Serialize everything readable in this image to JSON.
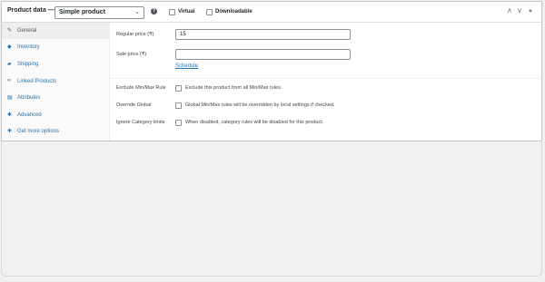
{
  "header": {
    "title": "Product data —",
    "product_type": "Simple product",
    "help_icon": "?",
    "virtual_label": "Virtual",
    "downloadable_label": "Downloadable",
    "controls": [
      "∧",
      "∨",
      "▲"
    ]
  },
  "tabs": [
    {
      "label": "General",
      "icon": "wrench-icon",
      "glyph": "✎",
      "active": true
    },
    {
      "label": "Inventory",
      "icon": "tag-icon",
      "glyph": "◆",
      "active": false
    },
    {
      "label": "Shipping",
      "icon": "truck-icon",
      "glyph": "▰",
      "active": false
    },
    {
      "label": "Linked Products",
      "icon": "link-icon",
      "glyph": "∞",
      "active": false
    },
    {
      "label": "Attributes",
      "icon": "list-icon",
      "glyph": "▤",
      "active": false
    },
    {
      "label": "Advanced",
      "icon": "gear-icon",
      "glyph": "✱",
      "active": false
    },
    {
      "label": "Get more options",
      "icon": "plugin-icon",
      "glyph": "✚",
      "active": false
    }
  ],
  "general": {
    "regular_price_label": "Regular price (₹)",
    "regular_price_value": "15",
    "sale_price_label": "Sale price (₹)",
    "sale_price_value": "",
    "schedule_link": "Schedule"
  },
  "minmax": {
    "exclude_label": "Exclude Min/Max Rule",
    "exclude_desc": "Exclude this product from all Min/Max rules.",
    "override_label": "Override Global",
    "override_desc": "Global Min/Max rules will be overridden by local settings if checked.",
    "ignore_label": "Ignore Category limits",
    "ignore_desc": "When disabled, category rules will be disabled for this product."
  }
}
